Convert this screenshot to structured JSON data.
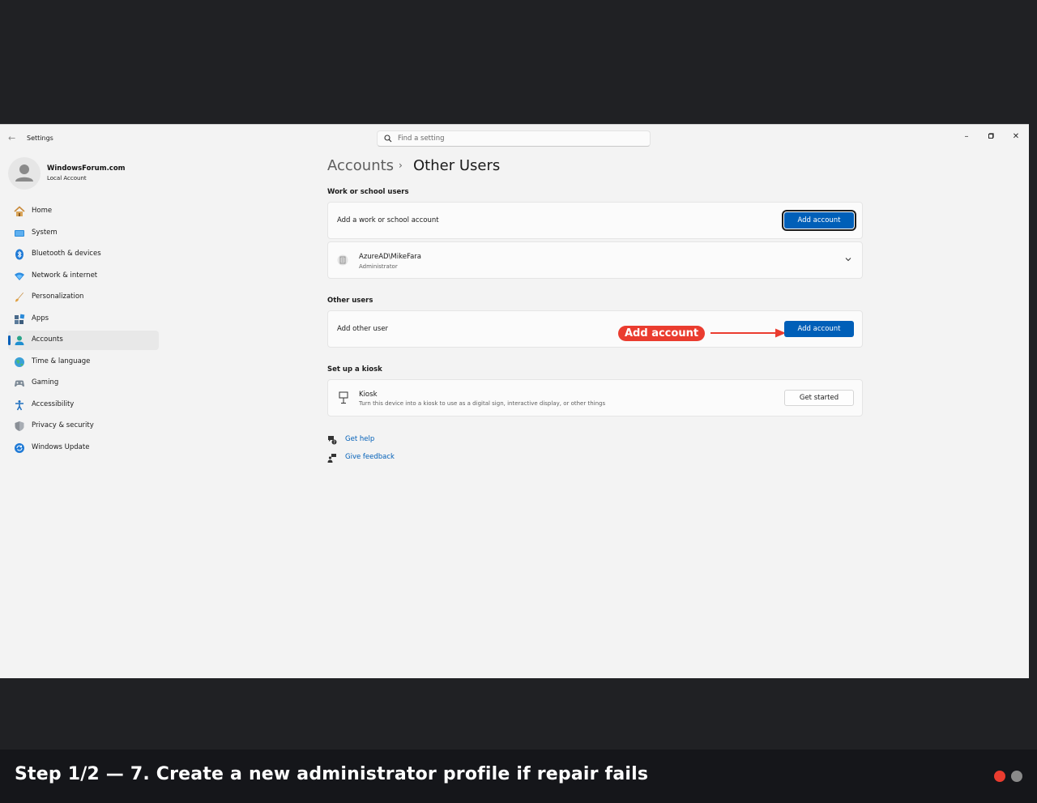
{
  "window": {
    "app_title": "Settings",
    "search_placeholder": "Find a setting",
    "controls": [
      "minimize-icon",
      "maximize-icon",
      "close-icon"
    ]
  },
  "profile": {
    "name": "WindowsForum.com",
    "account_type": "Local Account"
  },
  "sidebar": {
    "items": [
      {
        "label": "Home",
        "icon": "home-icon"
      },
      {
        "label": "System",
        "icon": "system-icon"
      },
      {
        "label": "Bluetooth & devices",
        "icon": "bluetooth-icon"
      },
      {
        "label": "Network & internet",
        "icon": "network-icon"
      },
      {
        "label": "Personalization",
        "icon": "brush-icon"
      },
      {
        "label": "Apps",
        "icon": "apps-icon"
      },
      {
        "label": "Accounts",
        "icon": "accounts-icon",
        "active": true
      },
      {
        "label": "Time & language",
        "icon": "globe-icon"
      },
      {
        "label": "Gaming",
        "icon": "gamepad-icon"
      },
      {
        "label": "Accessibility",
        "icon": "accessibility-icon"
      },
      {
        "label": "Privacy & security",
        "icon": "shield-icon"
      },
      {
        "label": "Windows Update",
        "icon": "update-icon"
      }
    ]
  },
  "breadcrumb": {
    "parent": "Accounts",
    "separator": "›",
    "current": "Other Users"
  },
  "work_school": {
    "section_title": "Work or school users",
    "add_label": "Add a work or school account",
    "add_button": "Add account",
    "user_name": "AzureAD\\MikeFara",
    "user_role": "Administrator"
  },
  "other_users": {
    "section_title": "Other users",
    "add_label": "Add other user",
    "add_button": "Add account",
    "callout": "Add account"
  },
  "kiosk": {
    "section_title": "Set up a kiosk",
    "title": "Kiosk",
    "description": "Turn this device into a kiosk to use as a digital sign, interactive display, or other things",
    "button": "Get started"
  },
  "links": {
    "help": "Get help",
    "feedback": "Give feedback"
  },
  "caption": {
    "text": "Step 1/2 — 7. Create a new administrator profile if repair fails"
  },
  "colors": {
    "accent": "#005fb8",
    "callout": "#ea3c2f",
    "dot_active": "#ea3c2f",
    "dot_inactive": "#8a8a8a"
  }
}
